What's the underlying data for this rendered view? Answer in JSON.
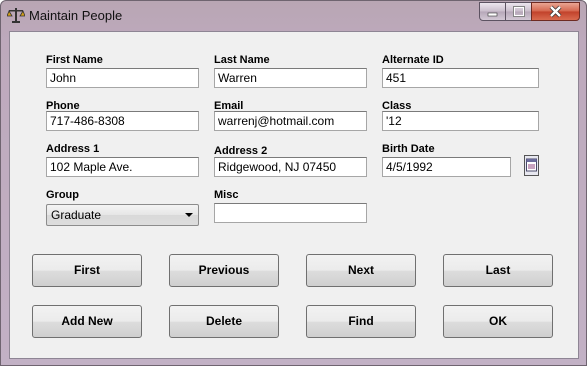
{
  "window": {
    "title": "Maintain People"
  },
  "form": {
    "first_name": {
      "label": "First Name",
      "value": "John"
    },
    "last_name": {
      "label": "Last Name",
      "value": "Warren"
    },
    "alternate_id": {
      "label": "Alternate ID",
      "value": "451"
    },
    "phone": {
      "label": "Phone",
      "value": "717-486-8308"
    },
    "email": {
      "label": "Email",
      "value": "warrenj@hotmail.com"
    },
    "class": {
      "label": "Class",
      "value": "'12"
    },
    "address1": {
      "label": "Address 1",
      "value": "102 Maple Ave."
    },
    "address2": {
      "label": "Address 2",
      "value": "Ridgewood, NJ 07450"
    },
    "birth_date": {
      "label": "Birth Date",
      "value": "4/5/1992"
    },
    "group": {
      "label": "Group",
      "value": "Graduate"
    },
    "misc": {
      "label": "Misc",
      "value": ""
    }
  },
  "buttons": {
    "first": "First",
    "previous": "Previous",
    "next": "Next",
    "last": "Last",
    "add_new": "Add New",
    "delete": "Delete",
    "find": "Find",
    "ok": "OK"
  },
  "icons": {
    "app": "scales-icon",
    "minimize": "minimize-icon",
    "maximize": "maximize-icon",
    "close": "close-icon",
    "calendar": "calendar-icon",
    "dropdown": "chevron-down-icon"
  }
}
